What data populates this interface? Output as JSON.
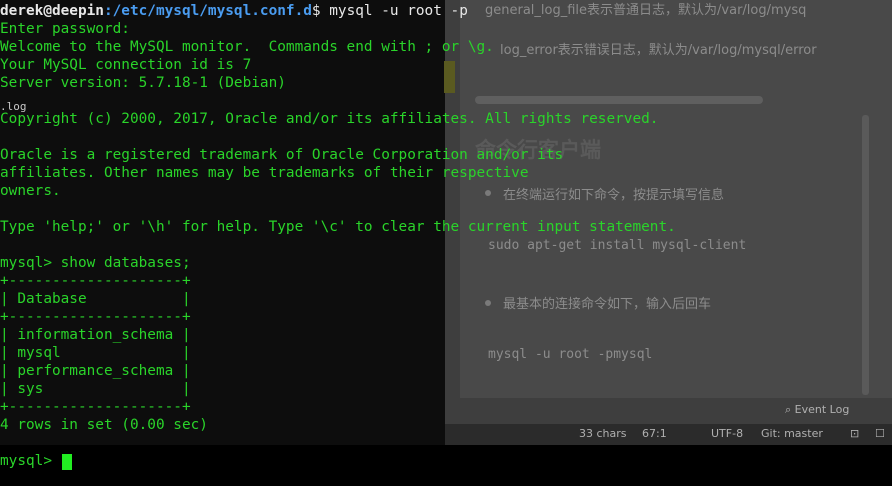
{
  "background_editor": {
    "lines_top": [
      "general_log_file表示普通日志，默认为/var/log/mysq",
      "log_error表示错误日志，默认为/var/log/mysql/error"
    ],
    "heading": "命令行客户端",
    "bullet1": "在终端运行如下命令，按提示填写信息",
    "code1": "sudo apt-get install mysql-client",
    "bullet2": "最基本的连接命令如下，输入后回车",
    "code2": "mysql -u root -pmysql",
    "event_log": "Event Log",
    "status": {
      "chars": "33 chars",
      "position": "67:1",
      "encoding": "UTF-8",
      "git": "Git: master"
    }
  },
  "terminal": {
    "prompt_user": "derek@deepin",
    "prompt_path": ":/etc/mysql/mysql.conf.d",
    "prompt_symbol": "$",
    "command": " mysql -u root -p",
    "lines": [
      "Enter password:",
      "Welcome to the MySQL monitor.  Commands end with ; or \\g.",
      "Your MySQL connection id is 7",
      "Server version: 5.7.18-1 (Debian)",
      ".log",
      "Copyright (c) 2000, 2017, Oracle and/or its affiliates. All rights reserved.",
      "",
      "Oracle is a registered trademark of Oracle Corporation and/or its",
      "affiliates. Other names may be trademarks of their respective",
      "owners.",
      "",
      "Type 'help;' or '\\h' for help. Type '\\c' to clear the current input statement.",
      "",
      "mysql> show databases;",
      "+--------------------+",
      "| Database           |",
      "+--------------------+",
      "| information_schema |",
      "| mysql              |",
      "| performance_schema |",
      "| sys                |",
      "+--------------------+",
      "4 rows in set (0.00 sec)"
    ],
    "active_prompt": "mysql>"
  },
  "colors": {
    "terminal_text": "#2ad42a",
    "prompt_path": "#4a9cf0",
    "cursor": "#22ee22"
  }
}
